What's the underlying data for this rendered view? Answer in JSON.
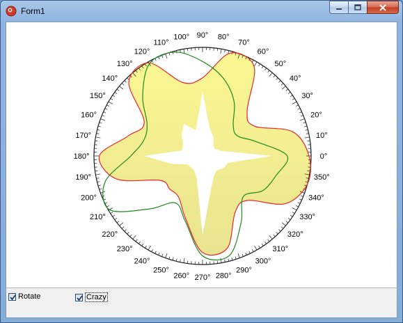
{
  "window": {
    "title": "Form1",
    "colors": {
      "accent": "#3a5d89",
      "close_red": "#c33b21"
    }
  },
  "controls": {
    "rotate": {
      "label": "Rotate",
      "checked": true
    },
    "crazy": {
      "label": "Crazy",
      "checked": true,
      "focused": true
    }
  },
  "chart_data": {
    "type": "polar",
    "fill_color": "#f7f28a",
    "curve_colors": [
      "#e8262b",
      "#1e8a1e"
    ],
    "angle_labels": [
      "0°",
      "10°",
      "20°",
      "30°",
      "40°",
      "50°",
      "60°",
      "70°",
      "80°",
      "90°",
      "100°",
      "110°",
      "120°",
      "130°",
      "140°",
      "150°",
      "160°",
      "170°",
      "180°",
      "190°",
      "200°",
      "210°",
      "220°",
      "230°",
      "240°",
      "250°",
      "260°",
      "270°",
      "280°",
      "290°",
      "300°",
      "310°",
      "320°",
      "330°",
      "340°",
      "350°"
    ],
    "radial_range": [
      0,
      1
    ],
    "series": [
      {
        "name": "",
        "color": "#e8262b",
        "theta_deg": [
          0,
          15,
          30,
          45,
          60,
          75,
          90,
          105,
          120,
          135,
          150,
          165,
          180,
          195,
          210,
          225,
          240,
          255,
          270,
          285,
          300,
          315,
          330,
          345,
          360
        ],
        "r": [
          0.98,
          0.86,
          0.55,
          0.58,
          0.95,
          0.98,
          0.72,
          0.7,
          0.99,
          0.96,
          0.62,
          0.71,
          0.95,
          0.82,
          0.45,
          0.43,
          0.44,
          0.6,
          0.89,
          0.88,
          0.6,
          0.58,
          0.88,
          1.0,
          0.98
        ]
      },
      {
        "name": "",
        "color": "#1e8a1e",
        "theta_deg": [
          0,
          15,
          30,
          45,
          60,
          75,
          90,
          105,
          120,
          135,
          150,
          165,
          180,
          195,
          210,
          225,
          240,
          255,
          270,
          285,
          300,
          315,
          330,
          345,
          360
        ],
        "r": [
          0.78,
          0.51,
          0.37,
          0.4,
          0.58,
          0.74,
          0.87,
          0.99,
          0.98,
          0.78,
          0.59,
          0.56,
          0.66,
          0.93,
          0.99,
          0.69,
          0.5,
          0.62,
          0.92,
          0.95,
          0.71,
          0.53,
          0.64,
          0.7,
          0.78
        ]
      }
    ]
  }
}
